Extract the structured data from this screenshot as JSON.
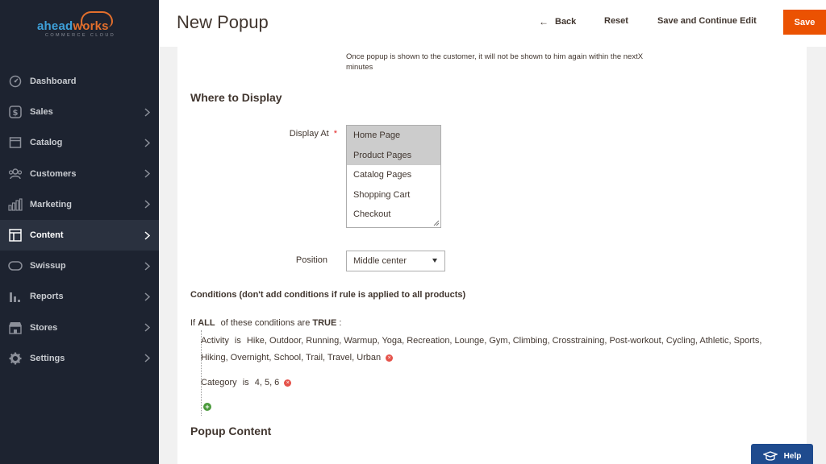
{
  "brand": {
    "name_a": "ahead",
    "name_b": "works",
    "sub": "COMMERCE CLOUD"
  },
  "sidebar": {
    "items": [
      {
        "label": "Dashboard",
        "icon": "dashboard-icon",
        "active": false
      },
      {
        "label": "Sales",
        "icon": "dollar-icon",
        "active": false
      },
      {
        "label": "Catalog",
        "icon": "box-icon",
        "active": false
      },
      {
        "label": "Customers",
        "icon": "users-icon",
        "active": false
      },
      {
        "label": "Marketing",
        "icon": "marketing-icon",
        "active": false
      },
      {
        "label": "Content",
        "icon": "layout-icon",
        "active": true
      },
      {
        "label": "Swissup",
        "icon": "toggle-icon",
        "active": false
      },
      {
        "label": "Reports",
        "icon": "bar-chart-icon",
        "active": false
      },
      {
        "label": "Stores",
        "icon": "store-icon",
        "active": false
      },
      {
        "label": "Settings",
        "icon": "gear-icon",
        "active": false
      }
    ]
  },
  "header": {
    "title": "New Popup",
    "back_label": "Back",
    "reset_label": "Reset",
    "save_continue_label": "Save and Continue Edit",
    "save_label": "Save"
  },
  "form": {
    "note": "Once popup is shown to the customer, it will not be shown to him again within the nextX minutes",
    "where_title": "Where to Display",
    "display_at": {
      "label": "Display At",
      "required_mark": "*",
      "options": [
        "Home Page",
        "Product Pages",
        "Catalog Pages",
        "Shopping Cart",
        "Checkout"
      ],
      "selected": [
        "Home Page",
        "Product Pages"
      ]
    },
    "position": {
      "label": "Position",
      "value": "Middle center"
    },
    "conditions": {
      "title": "Conditions (don't add conditions if rule is applied to all products)",
      "root_prefix": "If",
      "root_aggregator": "ALL",
      "root_middle": "of these conditions are",
      "root_value": "TRUE",
      "root_suffix": ":",
      "rows": [
        {
          "attribute": "Activity",
          "operator": "is",
          "value": "Hike, Outdoor, Running, Warmup, Yoga, Recreation, Lounge, Gym, Climbing, Crosstraining, Post-workout, Cycling, Athletic, Sports, Hiking, Overnight, School, Trail, Travel, Urban"
        },
        {
          "attribute": "Category",
          "operator": "is",
          "value": "4, 5, 6"
        }
      ]
    },
    "popup_content_title": "Popup Content"
  },
  "help": {
    "label": "Help"
  },
  "colors": {
    "accent": "#eb5202",
    "sidebar_bg": "#1d2330",
    "help_bg": "#1f4b8e"
  }
}
